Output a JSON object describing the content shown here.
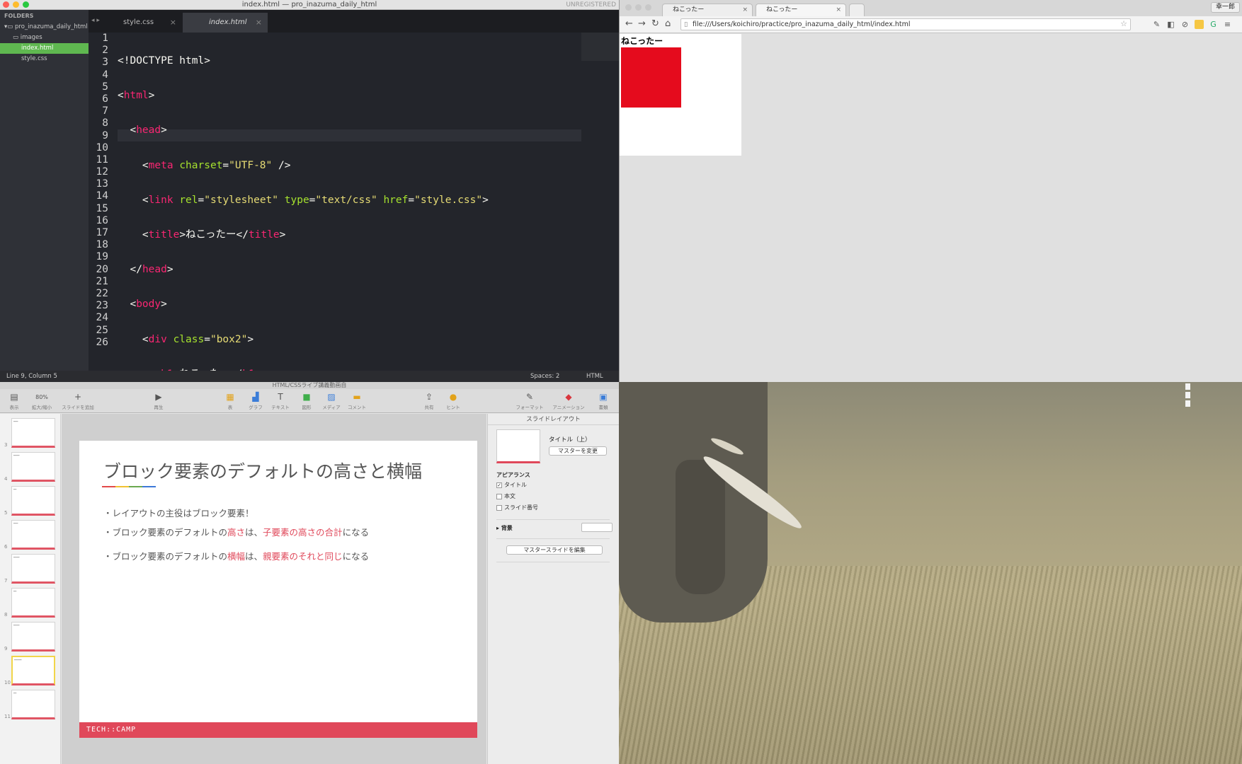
{
  "sublime": {
    "window_title": "index.html — pro_inazuma_daily_html",
    "unregistered": "UNREGISTERED",
    "sidebar": {
      "header": "FOLDERS",
      "project": "pro_inazuma_daily_html",
      "items": [
        "images",
        "index.html",
        "style.css"
      ]
    },
    "tabs": [
      "style.css",
      "index.html"
    ],
    "line_numbers": [
      "1",
      "2",
      "3",
      "4",
      "5",
      "6",
      "7",
      "8",
      "9",
      "10",
      "11",
      "12",
      "13",
      "14",
      "15",
      "16",
      "17",
      "18",
      "19",
      "20",
      "21",
      "22",
      "23",
      "24",
      "25",
      "26"
    ],
    "status": {
      "position": "Line 9, Column 5",
      "spaces": "Spaces: 2",
      "syntax": "HTML"
    }
  },
  "chrome": {
    "tabs": [
      "ねこったー",
      "ねこったー"
    ],
    "user": "幸一郎",
    "url": "file:///Users/koichiro/practice/pro_inazuma_daily_html/index.html",
    "page_heading": "ねこったー",
    "box_color": "#e50b1d"
  },
  "keynote": {
    "window_title": "HTML/CSSライブ講義動画自",
    "toolbar": {
      "view": "表示",
      "zoom_value": "80%",
      "zoom": "拡大/縮小",
      "add_slide": "スライドを追加",
      "play": "再生",
      "table": "表",
      "chart": "グラフ",
      "text": "テキスト",
      "shape": "図形",
      "media": "メディア",
      "comment": "コメント",
      "share": "共有",
      "tips": "ヒント",
      "format": "フォーマット",
      "animate": "アニメーション",
      "document": "書類"
    },
    "slide_numbers": [
      "3",
      "4",
      "5",
      "6",
      "7",
      "8",
      "9",
      "10",
      "11"
    ],
    "slide": {
      "title": "ブロック要素のデフォルトの高さと横幅",
      "bullet1": "・レイアウトの主役はブロック要素！",
      "bullet2_a": "・ブロック要素のデフォルトの",
      "bullet2_b": "高さ",
      "bullet2_c": "は、",
      "bullet2_d": "子要素の高さの合計",
      "bullet2_e": "になる",
      "bullet3_a": "・ブロック要素のデフォルトの",
      "bullet3_b": "横幅",
      "bullet3_c": "は、",
      "bullet3_d": "親要素のそれと同じ",
      "bullet3_e": "になる",
      "footer": "TECH::CAMP"
    },
    "inspector": {
      "header": "スライドレイアウト",
      "layout_name": "タイトル（上）",
      "change_master": "マスターを変更",
      "appearance": "アピアランス",
      "checks": [
        {
          "label": "タイトル",
          "checked": true
        },
        {
          "label": "本文",
          "checked": false
        },
        {
          "label": "スライド番号",
          "checked": false
        }
      ],
      "background": "背景",
      "edit_master": "マスタースライドを編集"
    }
  },
  "colors": {
    "accent_red": "#e0485a",
    "sublime_green": "#5fb850",
    "keyword_pink": "#f92672",
    "attr_green": "#a6e22e",
    "string_yellow": "#e6db74"
  }
}
